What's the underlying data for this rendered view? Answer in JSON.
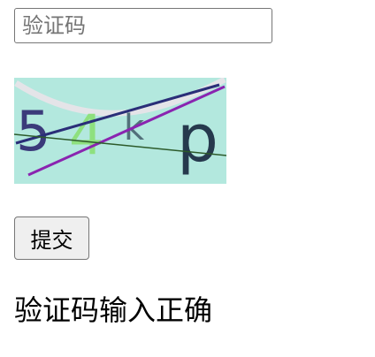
{
  "form": {
    "captcha_placeholder": "验证码",
    "captcha_value": "",
    "submit_label": "提交"
  },
  "captcha_image": {
    "characters": [
      "5",
      "4",
      "k",
      "p"
    ],
    "background_color": "#b3e8de",
    "char_colors": [
      "#3b3a7a",
      "#8ee07e",
      "#52707a",
      "#26394d"
    ]
  },
  "result": {
    "message": "验证码输入正确"
  }
}
